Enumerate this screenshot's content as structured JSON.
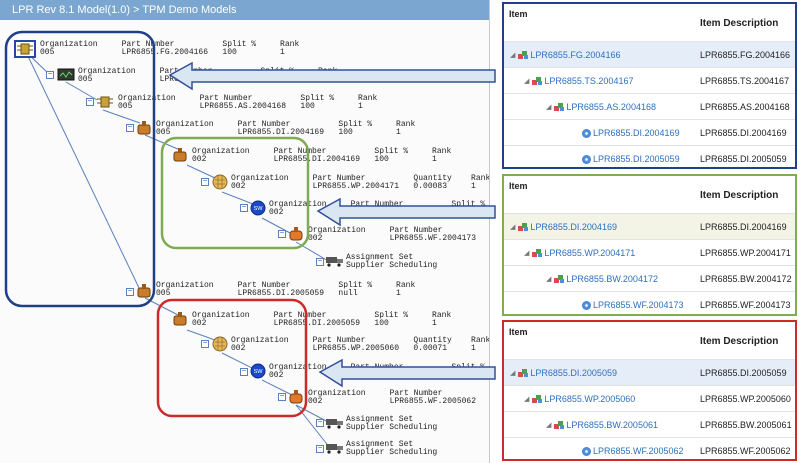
{
  "tree": {
    "title": "LPR Rev 8.1 Model(1.0) > TPM Demo Models",
    "nodes": [
      {
        "l1": "Organization     Part Number          Split %     Rank",
        "l2": "005              LPR6855.FG.2004166   100         1"
      },
      {
        "l1": "Organization     Part Number          Split %     Rank",
        "l2": "005              LPR6855.TS.2004167   100         1"
      },
      {
        "l1": "Organization     Part Number          Split %     Rank",
        "l2": "005              LPR6855.AS.2004168   100         1"
      },
      {
        "l1": "Organization     Part Number          Split %     Rank",
        "l2": "005              LPR6855.DI.2004169   100         1"
      },
      {
        "l1": "Organization     Part Number          Split %     Rank",
        "l2": "002              LPR6855.DI.2004169   100         1"
      },
      {
        "l1": "Organization     Part Number          Quantity    Rank",
        "l2": "002              LPR6855.WP.2004171   0.00083     1"
      },
      {
        "l1": "Organization     Part Number          Split %     Rank",
        "l2": "002              LPR6855.BW.2004172   100         1"
      },
      {
        "l1": "Organization     Part Number          Split %     Rank",
        "l2": "002              LPR6855.WF.2004173   100         1"
      },
      {
        "l1": "Assignment Set                        Rank",
        "l2": "Supplier Scheduling                   1"
      },
      {
        "l1": "Organization     Part Number          Split %     Rank",
        "l2": "005              LPR6855.DI.2005059   null        1"
      },
      {
        "l1": "Organization     Part Number          Split %     Rank",
        "l2": "002              LPR6855.DI.2005059   100         1"
      },
      {
        "l1": "Organization     Part Number          Quantity    Rank",
        "l2": "002              LPR6855.WP.2005060   0.00071     1"
      },
      {
        "l1": "Organization     Part Number          Split %     Rank",
        "l2": "002              LPR6855.BW.2005061   100         1"
      },
      {
        "l1": "Organization     Part Number          Split %     Rank",
        "l2": "002              LPR6855.WF.2005062   100         1"
      },
      {
        "l1": "Assignment Set                        Rank",
        "l2": "Supplier Scheduling                   1"
      },
      {
        "l1": "Assignment Set                        Rank",
        "l2": "Supplier Scheduling                   1"
      }
    ]
  },
  "panels": [
    {
      "header_item": "Item",
      "header_desc": "Item Description",
      "rows": [
        {
          "item": "LPR6855.FG.2004166",
          "desc": "LPR6855.FG.2004166",
          "icon": "bom-icon"
        },
        {
          "item": "LPR6855.TS.2004167",
          "desc": "LPR6855.TS.2004167",
          "icon": "bom-icon"
        },
        {
          "item": "LPR6855.AS.2004168",
          "desc": "LPR6855.AS.2004168",
          "icon": "bom-icon"
        },
        {
          "item": "LPR6855.DI.2004169",
          "desc": "LPR6855.DI.2004169",
          "icon": "gear-icon"
        },
        {
          "item": "LPR6855.DI.2005059",
          "desc": "LPR6855.DI.2005059",
          "icon": "gear-icon"
        }
      ]
    },
    {
      "header_item": "Item",
      "header_desc": "Item Description",
      "rows": [
        {
          "item": "LPR6855.DI.2004169",
          "desc": "LPR6855.DI.2004169",
          "icon": "bom-icon"
        },
        {
          "item": "LPR6855.WP.2004171",
          "desc": "LPR6855.WP.2004171",
          "icon": "bom-icon"
        },
        {
          "item": "LPR6855.BW.2004172",
          "desc": "LPR6855.BW.2004172",
          "icon": "bom-icon"
        },
        {
          "item": "LPR6855.WF.2004173",
          "desc": "LPR6855.WF.2004173",
          "icon": "gear-icon"
        }
      ]
    },
    {
      "header_item": "Item",
      "header_desc": "Item Description",
      "rows": [
        {
          "item": "LPR6855.DI.2005059",
          "desc": "LPR6855.DI.2005059",
          "icon": "bom-icon"
        },
        {
          "item": "LPR6855.WP.2005060",
          "desc": "LPR6855.WP.2005060",
          "icon": "bom-icon"
        },
        {
          "item": "LPR6855.BW.2005061",
          "desc": "LPR6855.BW.2005061",
          "icon": "bom-icon"
        },
        {
          "item": "LPR6855.WF.2005062",
          "desc": "LPR6855.WF.2005062",
          "icon": "gear-icon"
        }
      ]
    }
  ],
  "colors": {
    "header_bar": "#7aa6cf",
    "highlight_blue": "#1f3f86",
    "highlight_green": "#7fab52",
    "highlight_red": "#cc2b2b",
    "arrow_fill": "#dbe6f3",
    "arrow_stroke": "#32509a",
    "selected_row": "#e5eef8",
    "link": "#2d6fbf"
  }
}
